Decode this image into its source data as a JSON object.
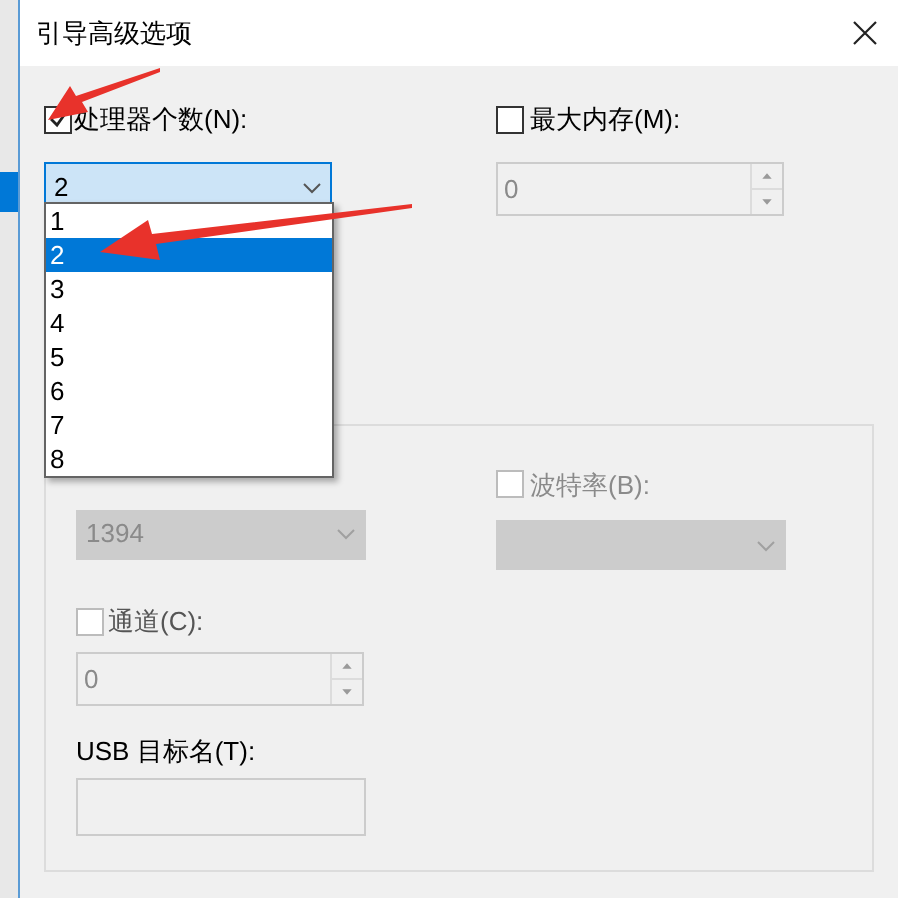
{
  "window": {
    "title": "引导高级选项"
  },
  "processors": {
    "label": "处理器个数(N):",
    "checked": true,
    "value": "2",
    "expanded": true,
    "options": [
      {
        "label": "1",
        "selected": false
      },
      {
        "label": "2",
        "selected": true
      },
      {
        "label": "3",
        "selected": false
      },
      {
        "label": "4",
        "selected": false
      },
      {
        "label": "5",
        "selected": false
      },
      {
        "label": "6",
        "selected": false
      },
      {
        "label": "7",
        "selected": false
      },
      {
        "label": "8",
        "selected": false
      }
    ]
  },
  "max_memory": {
    "label": "最大内存(M):",
    "checked": false,
    "value": "0",
    "disabled": true
  },
  "debug_port": {
    "value": "1394",
    "disabled": true
  },
  "baud_rate": {
    "label": "波特率(B):",
    "checked": false,
    "disabled": true
  },
  "channel": {
    "label": "通道(C):",
    "checked": false,
    "value": "0",
    "disabled": true
  },
  "usb_target": {
    "label": "USB 目标名(T):",
    "disabled": true
  }
}
